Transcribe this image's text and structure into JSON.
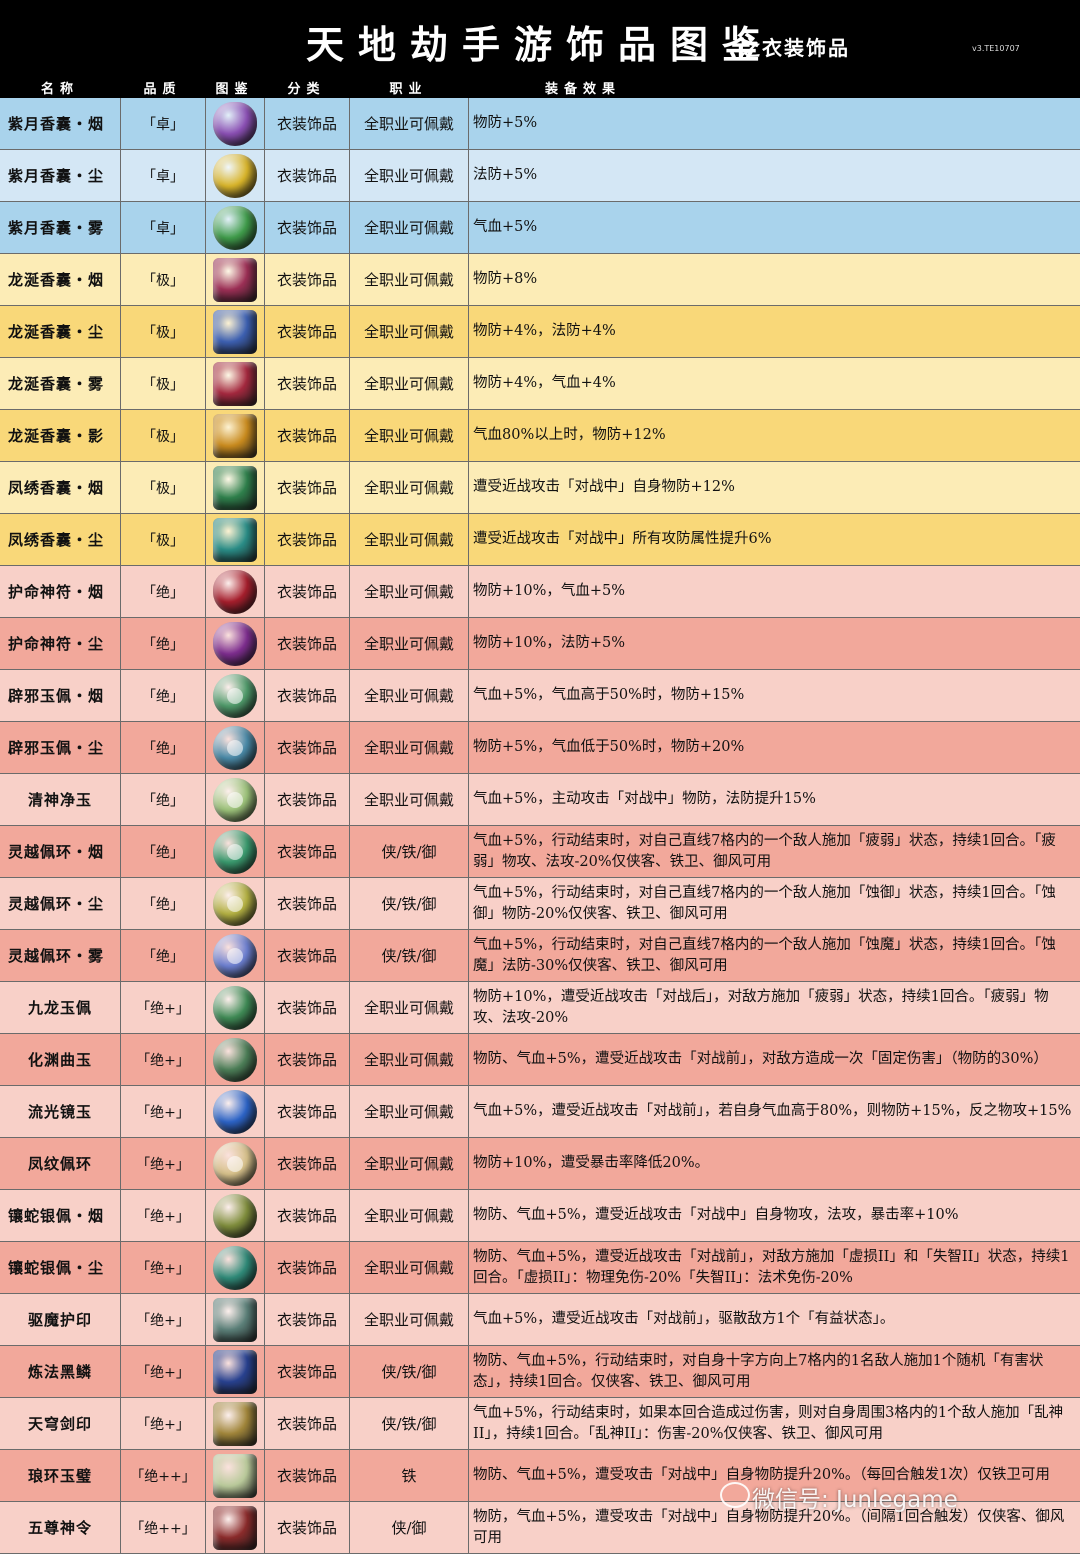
{
  "header": {
    "title": "天地劫手游饰品图鉴",
    "subtitle": "之衣装饰品",
    "version": "v3.TE10707"
  },
  "columns": [
    "名称",
    "品质",
    "图鉴",
    "分类",
    "职业",
    "装备效果"
  ],
  "rows": [
    {
      "name": "紫月香囊・烟",
      "grade": "「卓」",
      "icon": "purple-pouch-icon",
      "icon_color": "#8a4fb3",
      "category": "衣装饰品",
      "job": "全职业可佩戴",
      "effect": "物防+5%",
      "band": "blue",
      "alt": false
    },
    {
      "name": "紫月香囊・尘",
      "grade": "「卓」",
      "icon": "yellow-pouch-icon",
      "icon_color": "#d8b42a",
      "category": "衣装饰品",
      "job": "全职业可佩戴",
      "effect": "法防+5%",
      "band": "blue",
      "alt": true
    },
    {
      "name": "紫月香囊・雾",
      "grade": "「卓」",
      "icon": "green-pouch-icon",
      "icon_color": "#3f9b4a",
      "category": "衣装饰品",
      "job": "全职业可佩戴",
      "effect": "气血+5%",
      "band": "blue",
      "alt": false
    },
    {
      "name": "龙涎香囊・烟",
      "grade": "「极」",
      "icon": "red-embroidered-sachet-icon",
      "icon_color": "#9b2f55",
      "category": "衣装饰品",
      "job": "全职业可佩戴",
      "effect": "物防+8%",
      "band": "yellow",
      "alt": false
    },
    {
      "name": "龙涎香囊・尘",
      "grade": "「极」",
      "icon": "blue-embroidered-sachet-icon",
      "icon_color": "#3c5fb0",
      "category": "衣装饰品",
      "job": "全职业可佩戴",
      "effect": "物防+4%，法防+4%",
      "band": "yellow",
      "alt": true
    },
    {
      "name": "龙涎香囊・雾",
      "grade": "「极」",
      "icon": "crimson-embroidered-sachet-icon",
      "icon_color": "#a3283e",
      "category": "衣装饰品",
      "job": "全职业可佩戴",
      "effect": "物防+4%，气血+4%",
      "band": "yellow",
      "alt": false
    },
    {
      "name": "龙涎香囊・影",
      "grade": "「极」",
      "icon": "gold-embroidered-sachet-icon",
      "icon_color": "#c88a1e",
      "category": "衣装饰品",
      "job": "全职业可佩戴",
      "effect": "气血80%以上时，物防+12%",
      "band": "yellow",
      "alt": true
    },
    {
      "name": "凤绣香囊・烟",
      "grade": "「极」",
      "icon": "green-phoenix-sachet-icon",
      "icon_color": "#2e7f4b",
      "category": "衣装饰品",
      "job": "全职业可佩戴",
      "effect": "遭受近战攻击「对战中」自身物防+12%",
      "band": "yellow",
      "alt": false
    },
    {
      "name": "凤绣香囊・尘",
      "grade": "「极」",
      "icon": "teal-phoenix-sachet-icon",
      "icon_color": "#2a8c86",
      "category": "衣装饰品",
      "job": "全职业可佩戴",
      "effect": "遭受近战攻击「对战中」所有攻防属性提升6%",
      "band": "yellow",
      "alt": true
    },
    {
      "name": "护命神符・烟",
      "grade": "「绝」",
      "icon": "red-talisman-bag-icon",
      "icon_color": "#a51e2c",
      "category": "衣装饰品",
      "job": "全职业可佩戴",
      "effect": "物防+10%，气血+5%",
      "band": "pink",
      "alt": false
    },
    {
      "name": "护命神符・尘",
      "grade": "「绝」",
      "icon": "purple-talisman-bag-icon",
      "icon_color": "#7d2d8e",
      "category": "衣装饰品",
      "job": "全职业可佩戴",
      "effect": "物防+10%，法防+5%",
      "band": "pink",
      "alt": true
    },
    {
      "name": "辟邪玉佩・烟",
      "grade": "「绝」",
      "icon": "green-jade-disc-icon",
      "icon_color": "#4f9a6a",
      "category": "衣装饰品",
      "job": "全职业可佩戴",
      "effect": "气血+5%，气血高于50%时，物防+15%",
      "band": "pink",
      "alt": false
    },
    {
      "name": "辟邪玉佩・尘",
      "grade": "「绝」",
      "icon": "blue-jade-disc-icon",
      "icon_color": "#4a8aa8",
      "category": "衣装饰品",
      "job": "全职业可佩戴",
      "effect": "物防+5%，气血低于50%时，物防+20%",
      "band": "pink",
      "alt": true
    },
    {
      "name": "清神净玉",
      "grade": "「绝」",
      "icon": "pale-jade-disc-icon",
      "icon_color": "#9cc27a",
      "category": "衣装饰品",
      "job": "全职业可佩戴",
      "effect": "气血+5%，主动攻击「对战中」物防，法防提升15%",
      "band": "pink",
      "alt": false
    },
    {
      "name": "灵越佩环・烟",
      "grade": "「绝」",
      "icon": "green-ring-pendant-icon",
      "icon_color": "#3a9a6e",
      "category": "衣装饰品",
      "job": "侠/铁/御",
      "effect": "气血+5%，行动结束时，对自己直线7格内的一个敌人施加「疲弱」状态，持续1回合。「疲弱」物攻、法攻-20%仅侠客、铁卫、御风可用",
      "band": "pink",
      "alt": true
    },
    {
      "name": "灵越佩环・尘",
      "grade": "「绝」",
      "icon": "yellow-ring-pendant-icon",
      "icon_color": "#b3b042",
      "category": "衣装饰品",
      "job": "侠/铁/御",
      "effect": "气血+5%，行动结束时，对自己直线7格内的一个敌人施加「蚀御」状态，持续1回合。「蚀御」物防-20%仅侠客、铁卫、御风可用",
      "band": "pink",
      "alt": false
    },
    {
      "name": "灵越佩环・雾",
      "grade": "「绝」",
      "icon": "blue-ring-pendant-icon",
      "icon_color": "#6c7fd0",
      "category": "衣装饰品",
      "job": "侠/铁/御",
      "effect": "气血+5%，行动结束时，对自己直线7格内的一个敌人施加「蚀魔」状态，持续1回合。「蚀魔」法防-30%仅侠客、铁卫、御风可用",
      "band": "pink",
      "alt": true
    },
    {
      "name": "九龙玉佩",
      "grade": "「绝+」",
      "icon": "nine-dragon-jade-icon",
      "icon_color": "#3f8a55",
      "category": "衣装饰品",
      "job": "全职业可佩戴",
      "effect": "物防+10%，遭受近战攻击「对战后」，对敌方施加「疲弱」状态，持续1回合。「疲弱」物攻、法攻-20%",
      "band": "pink",
      "alt": false
    },
    {
      "name": "化渊曲玉",
      "grade": "「绝+」",
      "icon": "curved-jade-icon",
      "icon_color": "#4c7e57",
      "category": "衣装饰品",
      "job": "全职业可佩戴",
      "effect": "物防、气血+5%，遭受近战攻击「对战前」，对敌方造成一次「固定伤害」（物防的30%）",
      "band": "pink",
      "alt": true
    },
    {
      "name": "流光镜玉",
      "grade": "「绝+」",
      "icon": "blue-mirror-jade-icon",
      "icon_color": "#2c63c6",
      "category": "衣装饰品",
      "job": "全职业可佩戴",
      "effect": "气血+5%，遭受近战攻击「对战前」，若自身气血高于80%，则物防+15%，反之物攻+15%",
      "band": "pink",
      "alt": false
    },
    {
      "name": "凤纹佩环",
      "grade": "「绝+」",
      "icon": "phoenix-ring-icon",
      "icon_color": "#d6c08a",
      "category": "衣装饰品",
      "job": "全职业可佩戴",
      "effect": "物防+10%，遭受暴击率降低20%。",
      "band": "pink",
      "alt": true
    },
    {
      "name": "镶蛇银佩・烟",
      "grade": "「绝+」",
      "icon": "olive-serpent-medallion-icon",
      "icon_color": "#7f8d3c",
      "category": "衣装饰品",
      "job": "全职业可佩戴",
      "effect": "物防、气血+5%，遭受近战攻击「对战中」自身物攻，法攻，暴击率+10%",
      "band": "pink",
      "alt": false
    },
    {
      "name": "镶蛇银佩・尘",
      "grade": "「绝+」",
      "icon": "teal-serpent-medallion-icon",
      "icon_color": "#2f8a78",
      "category": "衣装饰品",
      "job": "全职业可佩戴",
      "effect": "物防、气血+5%，遭受近战攻击「对战前」，对敌方施加「虚损II」和「失智II」状态，持续1回合。「虚损II」：物理免伤-20%「失智II」：法术免伤-20%",
      "band": "pink",
      "alt": true
    },
    {
      "name": "驱魔护印",
      "grade": "「绝+」",
      "icon": "stone-seal-icon",
      "icon_color": "#5b7f78",
      "category": "衣装饰品",
      "job": "全职业可佩戴",
      "effect": "气血+5%，遭受近战攻击「对战前」，驱散敌方1个「有益状态」。",
      "band": "pink",
      "alt": false
    },
    {
      "name": "炼法黑鳞",
      "grade": "「绝+」",
      "icon": "black-scale-icon",
      "icon_color": "#28418f",
      "category": "衣装饰品",
      "job": "侠/铁/御",
      "effect": "物防、气血+5%，行动结束时，对自身十字方向上7格内的1名敌人施加1个随机「有害状态」，持续1回合。仅侠客、铁卫、御风可用",
      "band": "pink",
      "alt": true
    },
    {
      "name": "天穹剑印",
      "grade": "「绝+」",
      "icon": "sky-sword-seal-icon",
      "icon_color": "#a0853a",
      "category": "衣装饰品",
      "job": "侠/铁/御",
      "effect": "气血+5%，行动结束时，如果本回合造成过伤害，则对自身周围3格内的1个敌人施加「乱神II」，持续1回合。「乱神II」：伤害-20%仅侠客、铁卫、御风可用",
      "band": "pink",
      "alt": false
    },
    {
      "name": "琅环玉璧",
      "grade": "「绝++」",
      "icon": "jade-tablet-icon",
      "icon_color": "#b9c99a",
      "category": "衣装饰品",
      "job": "铁",
      "effect": "物防、气血+5%，遭受攻击「对战中」自身物防提升20%。（每回合触发1次）仅铁卫可用",
      "band": "pink",
      "alt": true
    },
    {
      "name": "五尊神令",
      "grade": "「绝++」",
      "icon": "five-lords-token-icon",
      "icon_color": "#8a2b2b",
      "category": "衣装饰品",
      "job": "侠/御",
      "effect": "物防，气血+5%，遭受攻击「对战中」自身物防提升20%。（间隔1回合触发）仅侠客、御风可用",
      "band": "pink",
      "alt": false
    }
  ],
  "watermark": "微信号: Junlegame"
}
